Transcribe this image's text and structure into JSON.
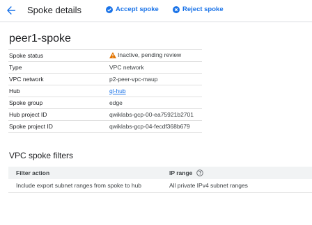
{
  "header": {
    "title": "Spoke details",
    "accept_label": "Accept spoke",
    "reject_label": "Reject spoke"
  },
  "spoke_name": "peer1-spoke",
  "details": {
    "rows": [
      {
        "label": "Spoke status",
        "value": "Inactive, pending review"
      },
      {
        "label": "Type",
        "value": "VPC network"
      },
      {
        "label": "VPC network",
        "value": "p2-peer-vpc-maup"
      },
      {
        "label": "Hub",
        "value": "ql-hub"
      },
      {
        "label": "Spoke group",
        "value": "edge"
      },
      {
        "label": "Hub project ID",
        "value": "qwiklabs-gcp-00-ea75921b2701"
      },
      {
        "label": "Spoke project ID",
        "value": "qwiklabs-gcp-04-fecdf368b679"
      }
    ]
  },
  "filters": {
    "title": "VPC spoke filters",
    "columns": [
      "Filter action",
      "IP range"
    ],
    "rows": [
      [
        "Include export subnet ranges from spoke to hub",
        "All private IPv4 subnet ranges"
      ]
    ]
  },
  "colors": {
    "accent": "#1a73e8",
    "warning": "#e37400"
  },
  "icons": {
    "back": "arrow-left-icon",
    "accept": "check-circle-icon",
    "reject": "x-circle-icon",
    "warning": "warning-triangle-icon",
    "help": "help-circle-icon"
  }
}
